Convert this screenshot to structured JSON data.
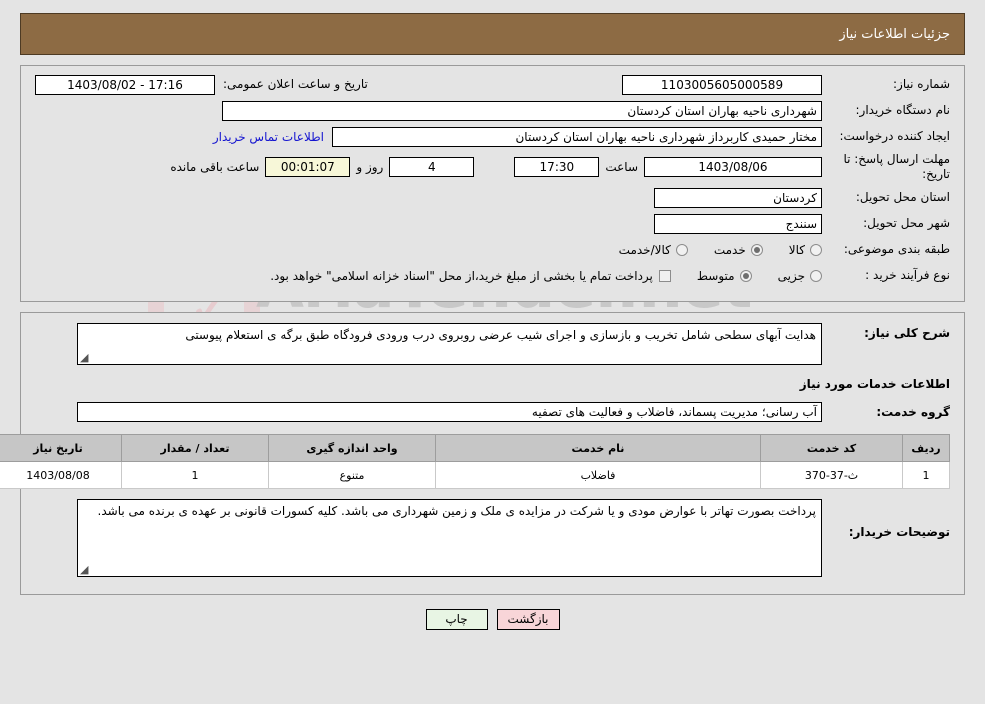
{
  "header": {
    "title": "جزئیات اطلاعات نیاز"
  },
  "watermark": {
    "text": "AriaTender.net"
  },
  "top_form": {
    "need_number_label": "شماره نیاز:",
    "need_number_value": "1103005605000589",
    "public_announcement_label": "تاریخ و ساعت اعلان عمومی:",
    "public_announcement_value": "17:16 - 1403/08/02",
    "buyer_org_label": "نام دستگاه خریدار:",
    "buyer_org_value": "شهرداری ناحیه بهاران استان کردستان",
    "creator_label": "ایجاد کننده درخواست:",
    "creator_value": "مختار حمیدی کاربرداز شهرداری ناحیه بهاران استان کردستان",
    "contact_link": "اطلاعات تماس خریدار",
    "deadline_label": "مهلت ارسال پاسخ: تا تاریخ:",
    "deadline_date": "1403/08/06",
    "hour_label": "ساعت",
    "deadline_time": "17:30",
    "days_value": "4",
    "days_label": "روز و",
    "countdown_value": "00:01:07",
    "remaining_label": "ساعت باقی مانده",
    "province_label": "استان محل تحویل:",
    "province_value": "کردستان",
    "city_label": "شهر محل تحویل:",
    "city_value": "سنندج",
    "category_label": "طبقه بندی موضوعی:",
    "category_options": [
      {
        "label": "کالا",
        "selected": false
      },
      {
        "label": "خدمت",
        "selected": true
      },
      {
        "label": "کالا/خدمت",
        "selected": false
      }
    ],
    "process_label": "نوع فرآیند خرید :",
    "process_options": [
      {
        "label": "جزیی",
        "selected": false
      },
      {
        "label": "متوسط",
        "selected": true
      }
    ],
    "treasury_checkbox_checked": false,
    "treasury_note": "پرداخت تمام یا بخشی از مبلغ خرید،از محل \"اسناد خزانه اسلامی\" خواهد بود."
  },
  "details": {
    "description_label": "شرح کلی نیاز:",
    "description_value": "هدایت آبهای سطحی شامل تخریب و بازسازی و اجرای شیب عرضی روبروی درب ورودی فرودگاه طبق برگه ی استعلام پیوستی",
    "services_section_title": "اطلاعات خدمات مورد نیاز",
    "service_group_label": "گروه خدمت:",
    "service_group_value": "آب رسانی؛ مدیریت پسماند، فاضلاب و فعالیت های تصفیه",
    "buyer_notes_label": "توضیحات خریدار:",
    "buyer_notes_value": "پرداخت بصورت تهاتر با عوارض مودی و یا شرکت در مزایده ی ملک و زمین شهرداری می باشد. کلیه کسورات قانونی بر عهده ی برنده می باشد."
  },
  "items_table": {
    "columns": [
      "ردیف",
      "کد خدمت",
      "نام خدمت",
      "واحد اندازه گیری",
      "تعداد / مقدار",
      "تاریخ نیاز"
    ],
    "rows": [
      {
        "row": "1",
        "code": "ث-37-370",
        "name": "فاضلاب",
        "unit": "متنوع",
        "quantity": "1",
        "need_date": "1403/08/08"
      }
    ]
  },
  "buttons": {
    "back": "بازگشت",
    "print": "چاپ"
  },
  "colors": {
    "header_bg": "#8d6b44",
    "page_bg": "#e4e4e4",
    "link": "#1414d0",
    "back_btn": "#f8d5d8",
    "print_btn": "#e8f5e4",
    "table_head": "#c6c6c6",
    "countdown_bg": "#f7f7d8"
  }
}
